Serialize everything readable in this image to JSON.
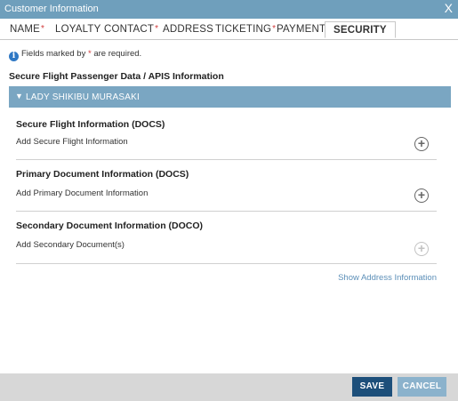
{
  "window": {
    "title": "Customer Information",
    "close_glyph": "X"
  },
  "tabs": [
    {
      "label": "NAME",
      "required": true
    },
    {
      "label": "LOYALTY",
      "required": false
    },
    {
      "label": "CONTACT",
      "required": true
    },
    {
      "label": "ADDRESS",
      "required": false
    },
    {
      "label": "TICKETING",
      "required": true
    },
    {
      "label": "PAYMENT",
      "required": false
    },
    {
      "label": "SECURITY",
      "required": false,
      "active": true
    }
  ],
  "required_marker": "*",
  "note": {
    "icon": "info-icon",
    "prefix": "Fields marked by ",
    "marker": "*",
    "suffix": " are required."
  },
  "section_title": "Secure Flight Passenger Data / APIS Information",
  "passenger": {
    "toggle_glyph": "▼",
    "name": "LADY SHIKIBU MURASAKI"
  },
  "blocks": [
    {
      "title": "Secure Flight Information (DOCS)",
      "link": "Add Secure Flight Information",
      "enabled": true
    },
    {
      "title": "Primary Document Information (DOCS)",
      "link": "Add Primary Document Information",
      "enabled": true
    },
    {
      "title": "Secondary Document Information (DOCO)",
      "link": "Add Secondary Document(s)",
      "enabled": false
    }
  ],
  "show_address_link": "Show Address Information",
  "footer": {
    "save_label": "SAVE",
    "cancel_label": "CANCEL"
  },
  "colors": {
    "title_bar": "#6f9fbc",
    "passenger_bar": "#7aa6c2",
    "required": "#d23b3b",
    "save": "#1d4f7a",
    "cancel": "#8bb2cc",
    "link": "#5c8fb8"
  }
}
